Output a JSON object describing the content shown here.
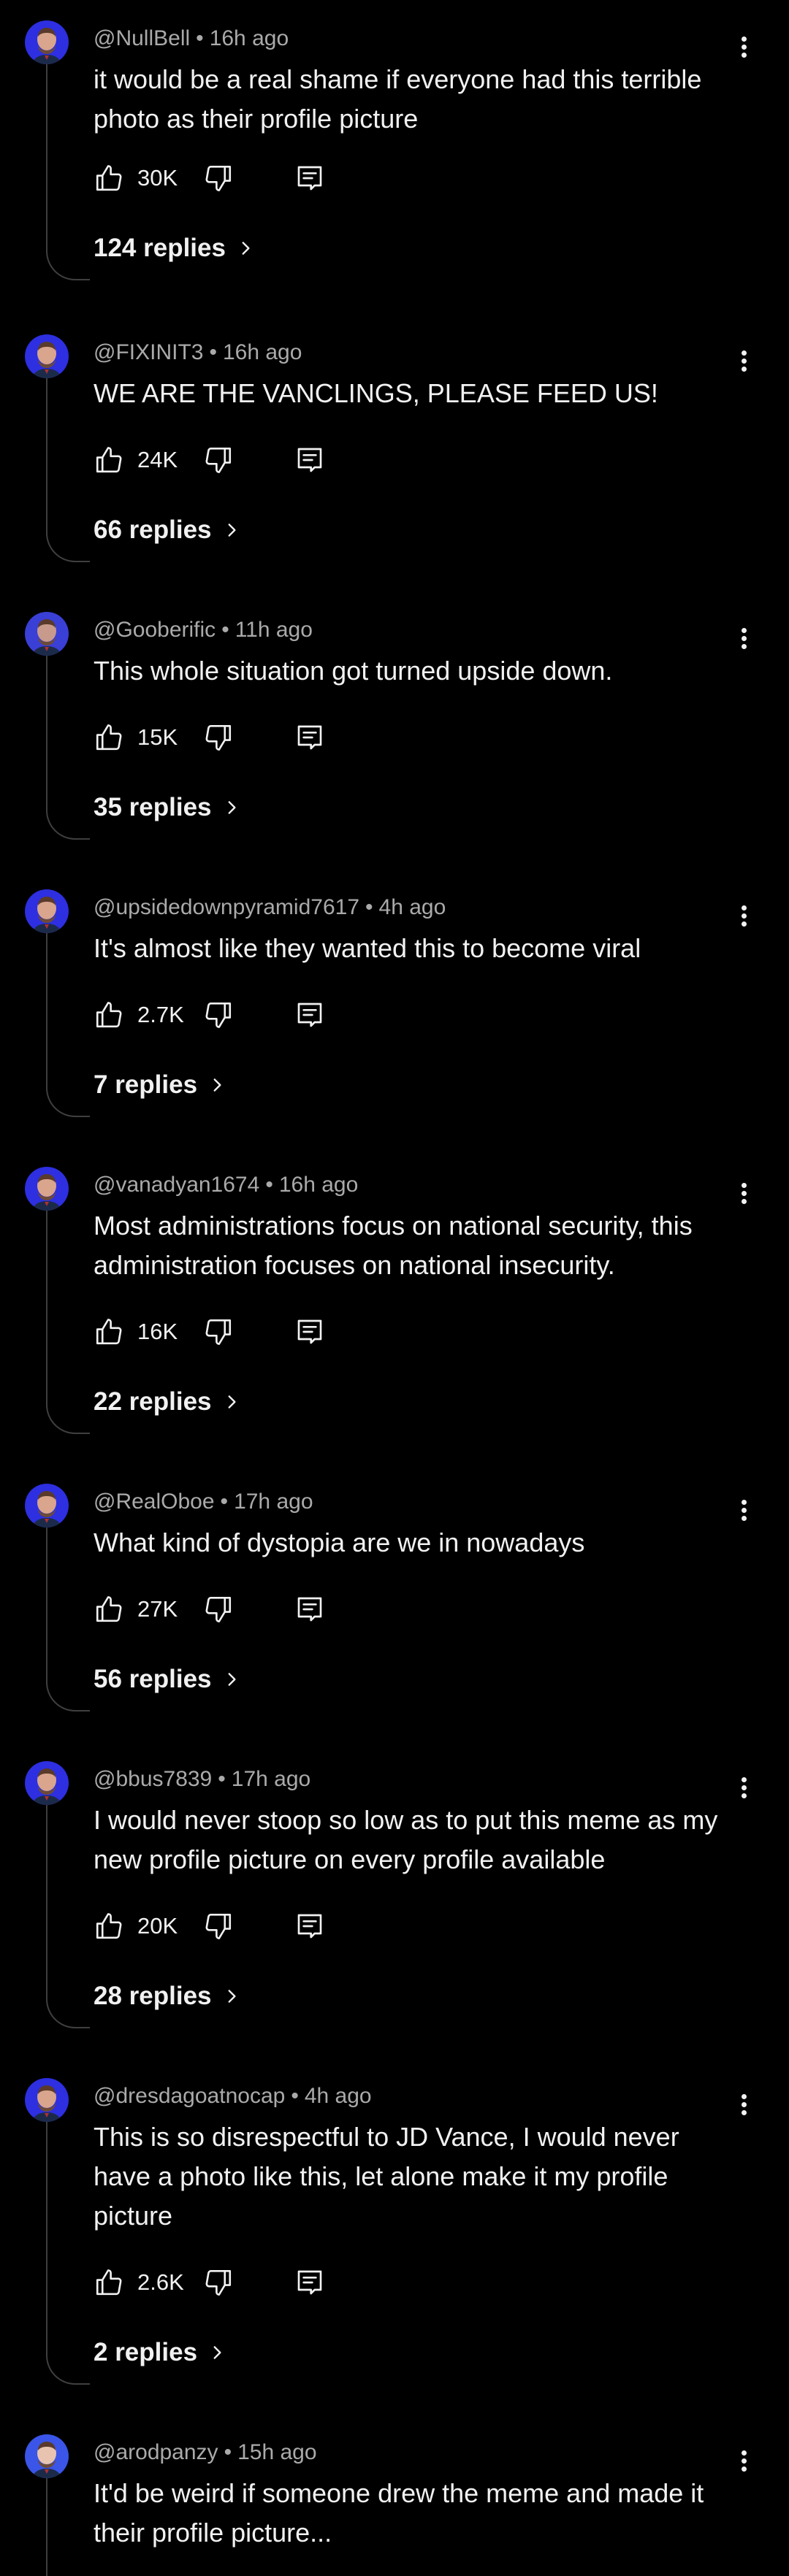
{
  "comments": [
    {
      "user": "@NullBell",
      "time": "16h ago",
      "text": "it would be a real shame if everyone had this terrible photo as their profile picture",
      "likes": "30K",
      "replies": "124 replies",
      "avatar_bg": "#2d2fe0",
      "avatar_face": "#d9a58c"
    },
    {
      "user": "@FIXINIT3",
      "time": "16h ago",
      "text": "WE ARE THE VANCLINGS, PLEASE FEED US!",
      "likes": "24K",
      "replies": "66 replies",
      "avatar_bg": "#2d2fe0",
      "avatar_face": "#d9a58c"
    },
    {
      "user": "@Gooberific",
      "time": "11h ago",
      "text": "This whole situation got turned upside down.",
      "likes": "15K",
      "replies": "35 replies",
      "avatar_bg": "#3a3fd6",
      "avatar_face": "#c89a8c"
    },
    {
      "user": "@upsidedownpyramid7617",
      "time": "4h ago",
      "text": "It's almost like they wanted this to become viral",
      "likes": "2.7K",
      "replies": "7 replies",
      "avatar_bg": "#2d2fe0",
      "avatar_face": "#d9a58c"
    },
    {
      "user": "@vanadyan1674",
      "time": "16h ago",
      "text": "Most administrations focus on national security, this administration focuses on national insecurity.",
      "likes": "16K",
      "replies": "22 replies",
      "avatar_bg": "#2d2fe0",
      "avatar_face": "#d9a58c"
    },
    {
      "user": "@RealOboe",
      "time": "17h ago",
      "text": "What kind of dystopia are we in nowadays",
      "likes": "27K",
      "replies": "56 replies",
      "avatar_bg": "#2d2fe0",
      "avatar_face": "#d9a58c"
    },
    {
      "user": "@bbus7839",
      "time": "17h ago",
      "text": "I would never stoop so low as to put this meme as my new profile picture on every profile available",
      "likes": "20K",
      "replies": "28 replies",
      "avatar_bg": "#2d2fe0",
      "avatar_face": "#d9a58c"
    },
    {
      "user": "@dresdagoatnocap",
      "time": "4h ago",
      "text": "This is so disrespectful to JD Vance, I would never have a photo like this, let alone make it my profile picture",
      "likes": "2.6K",
      "replies": "2 replies",
      "avatar_bg": "#2d2fe0",
      "avatar_face": "#d9a58c"
    },
    {
      "user": "@arodpanzy",
      "time": "15h ago",
      "text": "It'd be weird if someone drew the meme and made it their profile picture...",
      "likes": "",
      "replies": "",
      "avatar_bg": "#3a55e8",
      "avatar_face": "#e8c4b0"
    }
  ]
}
